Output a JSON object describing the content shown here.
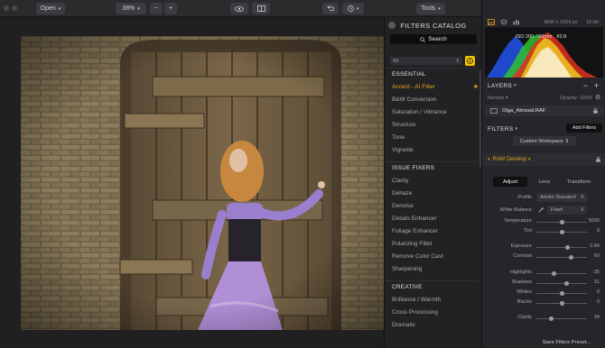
{
  "toolbar": {
    "open_label": "Open",
    "zoom_label": "38%",
    "zoom_out_symbol": "−",
    "zoom_in_symbol": "+",
    "tools_label": "Tools",
    "icons": [
      "folder-icon",
      "minus-icon",
      "plus-icon",
      "eye-icon",
      "compare-icon",
      "undo-icon",
      "history-icon",
      "glasses-icon",
      "sliders-icon"
    ]
  },
  "catalog": {
    "title": "FILTERS CATALOG",
    "search_label": "Search",
    "filter_select": "All",
    "sections": [
      {
        "title": "ESSENTIAL",
        "items": [
          "Accent - AI Filter",
          "B&W Conversion",
          "Saturation / Vibrance",
          "Structure",
          "Tone",
          "Vignette"
        ]
      },
      {
        "title": "ISSUE FIXERS",
        "items": [
          "Clarity",
          "Dehaze",
          "Denoise",
          "Details Enhancer",
          "Foliage Enhancer",
          "Polarizing Filter",
          "Remove Color Cast",
          "Sharpening"
        ]
      },
      {
        "title": "CREATIVE",
        "items": [
          "Brilliance / Warmth",
          "Cross Processing",
          "Dramatic"
        ]
      }
    ],
    "accent_color": "#e6a21c"
  },
  "panel": {
    "image_size": "4896 x 3264 px",
    "bit_depth": "16-bit",
    "iso": "ISO 200",
    "focal": "66mm",
    "aperture": "f/2.8",
    "layers_title": "LAYERS",
    "blend_mode": "Normal",
    "opacity_label": "Opacity: 100%",
    "layer_name": "Olga_Abrisad.RAF",
    "filters_title": "FILTERS",
    "add_filters": "Add Filters",
    "workspace": "Custom Workspace",
    "raw_title": "RAW Develop",
    "tabs": [
      "Adjust",
      "Lens",
      "Transform"
    ],
    "profile_label": "Profile",
    "profile_value": "Adobe Standard",
    "wb_label": "White Balance",
    "wb_value": "Flash",
    "save_preset": "Save Filters Preset...",
    "sliders": [
      {
        "label": "Temperature",
        "value": "5000",
        "pos": 0.5
      },
      {
        "label": "Tint",
        "value": "0",
        "pos": 0.5
      },
      {
        "label": "Exposure",
        "value": "0.84",
        "pos": 0.62
      },
      {
        "label": "Contrast",
        "value": "60",
        "pos": 0.68
      },
      {
        "label": "Highlights",
        "value": "-35",
        "pos": 0.35
      },
      {
        "label": "Shadows",
        "value": "31",
        "pos": 0.6
      },
      {
        "label": "Whites",
        "value": "0",
        "pos": 0.5
      },
      {
        "label": "Blacks",
        "value": "0",
        "pos": 0.5
      },
      {
        "label": "Clarity",
        "value": "34",
        "pos": 0.3
      }
    ]
  }
}
